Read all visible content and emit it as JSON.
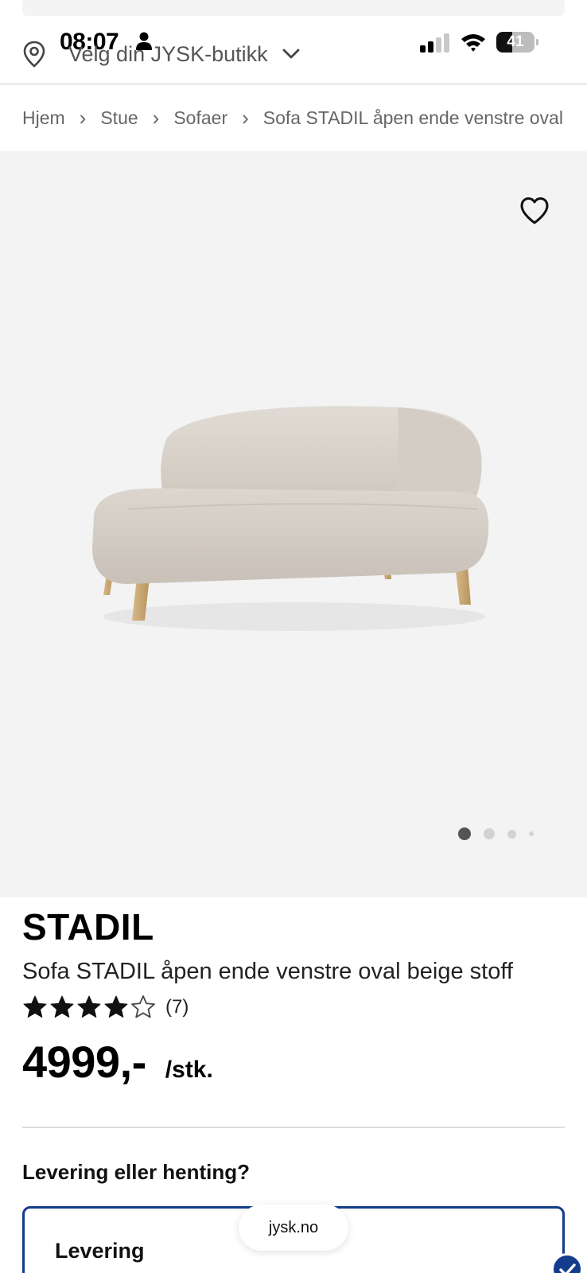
{
  "status_bar": {
    "time": "08:07",
    "battery_level": "41",
    "battery_fraction": 0.41
  },
  "header": {
    "store_selector": "Velg din JYSK-butikk"
  },
  "breadcrumb": {
    "items": [
      "Hjem",
      "Stue",
      "Sofaer",
      "Sofa STADIL åpen ende venstre oval b"
    ]
  },
  "gallery": {
    "image_count": 4,
    "active_index": 0
  },
  "product": {
    "brand": "STADIL",
    "name": "Sofa STADIL åpen ende venstre oval beige stoff",
    "rating": 4,
    "rating_max": 5,
    "review_count": "(7)",
    "price": "4999,-",
    "price_unit": "/stk."
  },
  "delivery": {
    "heading": "Levering eller henting?",
    "option_label": "Levering",
    "selected": true
  },
  "browser": {
    "url": "jysk.no"
  },
  "colors": {
    "accent": "#143c8c",
    "text": "#111111",
    "muted": "#666666",
    "gallery_bg": "#f3f3f3"
  },
  "icons": [
    "person-icon",
    "signal-icon",
    "wifi-icon",
    "battery-icon",
    "location-pin-icon",
    "chevron-down-icon",
    "chevron-right-icon",
    "heart-icon",
    "star-icon",
    "check-icon"
  ]
}
